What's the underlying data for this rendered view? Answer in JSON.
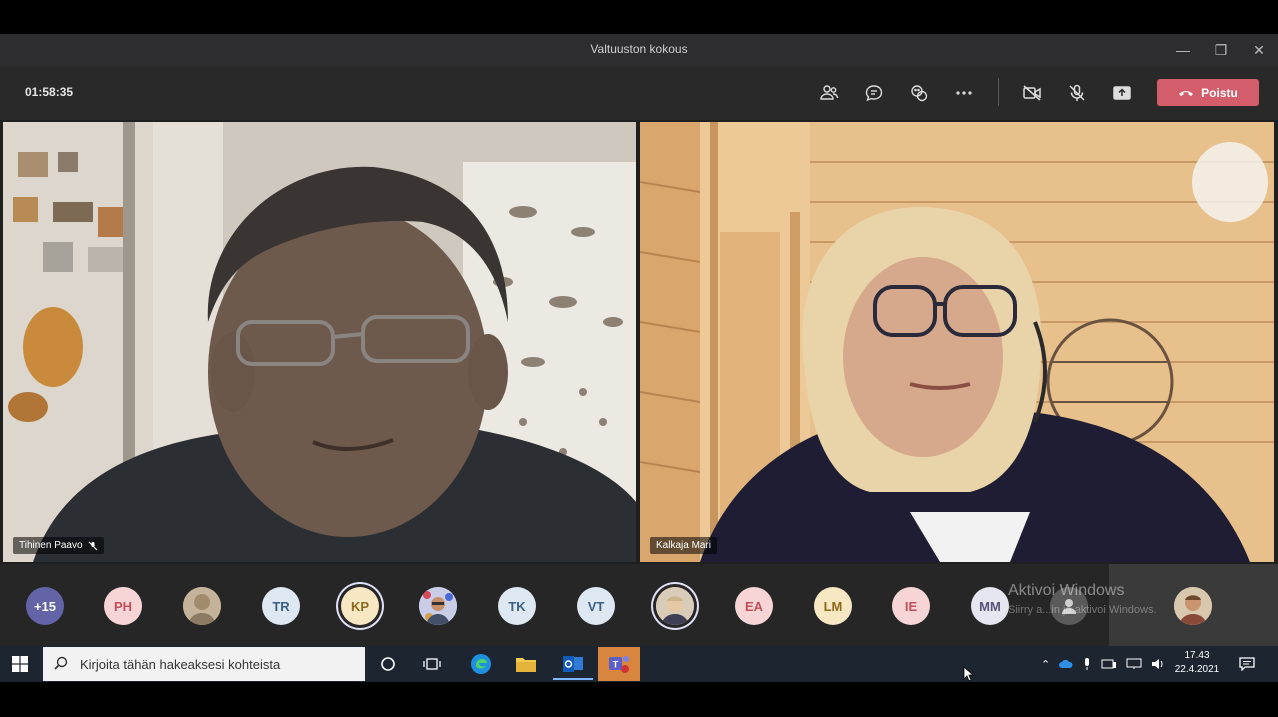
{
  "window": {
    "title": "Valtuuston kokous",
    "controls": [
      "minimize-icon",
      "restore-icon",
      "close-icon"
    ]
  },
  "toolbar": {
    "timer": "01:58:35",
    "buttons": [
      "people-icon",
      "chat-icon",
      "reactions-icon",
      "more-icon",
      "camera-off-icon",
      "mic-off-icon",
      "share-icon"
    ],
    "leave_label": "Poistu",
    "leave_color": "#d35d6a"
  },
  "videos": [
    {
      "name": "Tihinen Paavo",
      "muted": true
    },
    {
      "name": "Kalkaja Mari",
      "muted": false
    }
  ],
  "participants": [
    {
      "initials": "+15",
      "bg": "#6264a7",
      "fg": "#ffffff"
    },
    {
      "initials": "PH",
      "bg": "#f7d5d7",
      "fg": "#c0505a"
    },
    {
      "initials": "",
      "photo": true
    },
    {
      "initials": "TR",
      "bg": "#dde8f3",
      "fg": "#3c5f82"
    },
    {
      "initials": "KP",
      "bg": "#f7e7c2",
      "fg": "#8a6a1d",
      "active": true
    },
    {
      "initials": "",
      "photo": true
    },
    {
      "initials": "TK",
      "bg": "#dde8f3",
      "fg": "#3c5f82"
    },
    {
      "initials": "VT",
      "bg": "#dde8f3",
      "fg": "#3c5f82"
    },
    {
      "initials": "",
      "photo": true,
      "active": true
    },
    {
      "initials": "EA",
      "bg": "#f7d5d7",
      "fg": "#c0505a"
    },
    {
      "initials": "LM",
      "bg": "#f7e7c2",
      "fg": "#8a6a1d"
    },
    {
      "initials": "IE",
      "bg": "#f7d5d7",
      "fg": "#c0505a"
    },
    {
      "initials": "MM",
      "bg": "#e6e6f0",
      "fg": "#555577"
    }
  ],
  "watermark": {
    "line1": "Aktivoi Windows",
    "line2": "Siirry a...in ja aktivoi Windows."
  },
  "taskbar": {
    "search_placeholder": "Kirjoita tähän hakeaksesi kohteista",
    "time": "17.43",
    "date": "22.4.2021"
  }
}
